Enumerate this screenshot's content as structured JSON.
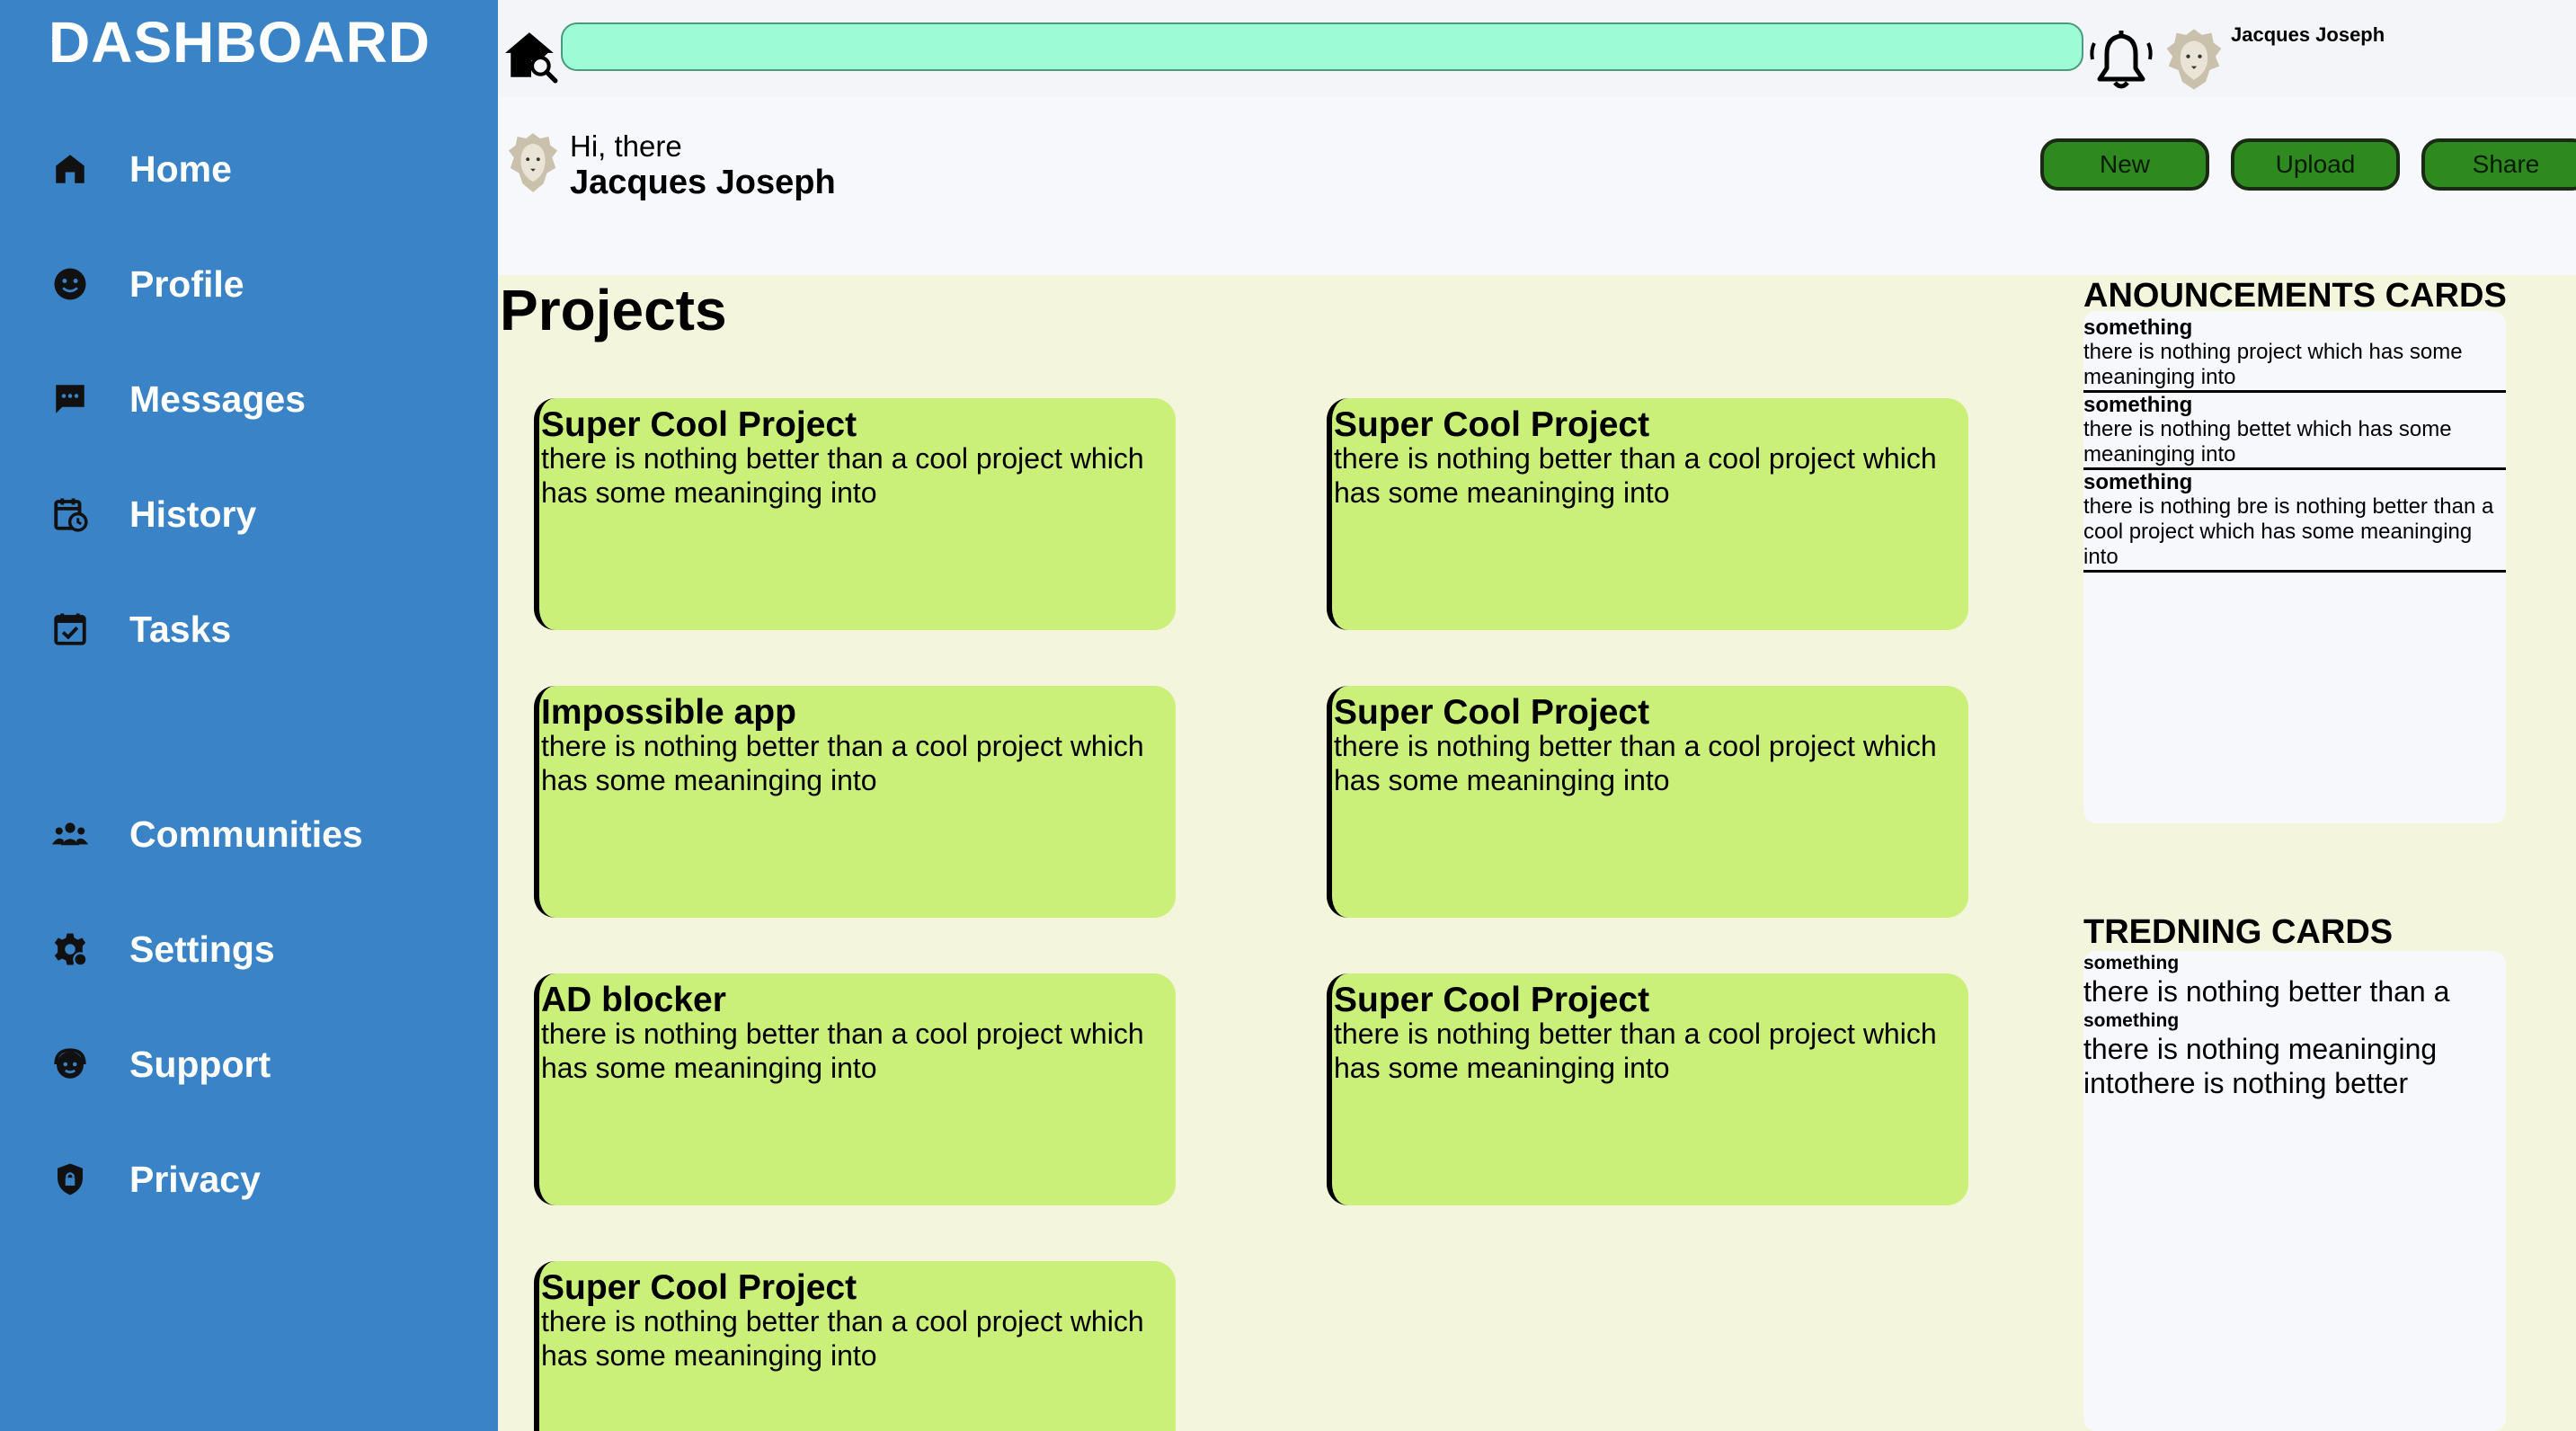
{
  "sidebar": {
    "logo": "DASHBOARD",
    "items": [
      {
        "label": "Home",
        "icon": "home-icon"
      },
      {
        "label": "Profile",
        "icon": "smiley-icon"
      },
      {
        "label": "Messages",
        "icon": "message-icon"
      },
      {
        "label": "History",
        "icon": "history-icon"
      },
      {
        "label": "Tasks",
        "icon": "calendar-check-icon"
      },
      {
        "label": "Communities",
        "icon": "people-icon"
      },
      {
        "label": "Settings",
        "icon": "gear-icon"
      },
      {
        "label": "Support",
        "icon": "support-icon"
      },
      {
        "label": "Privacy",
        "icon": "shield-lock-icon"
      }
    ]
  },
  "header": {
    "search_value": "",
    "user_name": "Jacques Joseph"
  },
  "greeting": {
    "hi": "Hi, there",
    "name": "Jacques Joseph"
  },
  "actions": {
    "new": "New",
    "upload": "Upload",
    "share": "Share"
  },
  "projects": {
    "title": "Projects",
    "cards": [
      {
        "title": "Super Cool Project",
        "desc": "there is nothing better than a cool project which has some meaninging into"
      },
      {
        "title": "Super Cool Project",
        "desc": "there is nothing better than a cool project which has some meaninging into"
      },
      {
        "title": "Impossible app",
        "desc": "there is nothing better than a cool project which has some meaninging into"
      },
      {
        "title": "Super Cool Project",
        "desc": "there is nothing better than a cool project which has some meaninging into"
      },
      {
        "title": "AD blocker",
        "desc": "there is nothing better than a cool project which has some meaninging into"
      },
      {
        "title": "Super Cool Project",
        "desc": "there is nothing better than a cool project which has some meaninging into"
      },
      {
        "title": "Super Cool Project",
        "desc": "there is nothing better than a cool project which has some meaninging into"
      }
    ]
  },
  "announcements": {
    "title": "ANOUNCEMENTS CARDS",
    "items": [
      {
        "title": "something",
        "desc": "there is nothing project which has some meaninging into"
      },
      {
        "title": "something",
        "desc": "there is nothing bettet which has some meaninging into"
      },
      {
        "title": "something",
        "desc": "there is nothing bre is nothing better than a cool project which has some meaninging into"
      }
    ]
  },
  "trending": {
    "title": "TREDNING CARDS",
    "items": [
      {
        "title": "something",
        "desc": "there is nothing better than a"
      },
      {
        "title": "something",
        "desc": "there is nothing meaninging intothere is nothing better"
      }
    ]
  },
  "colors": {
    "sidebar": "#3a83c6",
    "search": "#9dfcd6",
    "card": "#cbf07a",
    "button": "#2e8a1f",
    "content_bg": "#f3f5dc"
  }
}
